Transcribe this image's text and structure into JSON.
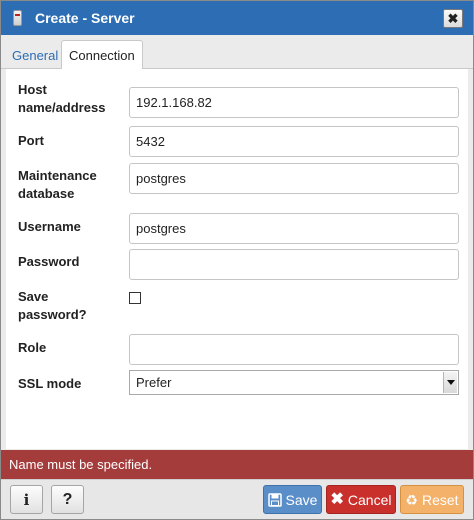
{
  "window": {
    "title": "Create - Server",
    "close_glyph": "✖",
    "title_icon": "server-icon"
  },
  "tabs": [
    {
      "label": "General",
      "active": false
    },
    {
      "label": "Connection",
      "active": true
    }
  ],
  "form": {
    "host": {
      "label": "Host\nname/address",
      "value": "192.1.168.82"
    },
    "port": {
      "label": "Port",
      "value": "5432"
    },
    "maintenance_db": {
      "label": "Maintenance\ndatabase",
      "value": "postgres"
    },
    "username": {
      "label": "Username",
      "value": "postgres"
    },
    "password": {
      "label": "Password",
      "value": ""
    },
    "save_password": {
      "label": "Save\npassword?",
      "checked": false
    },
    "role": {
      "label": "Role",
      "value": ""
    },
    "ssl_mode": {
      "label": "SSL mode",
      "value": "Prefer"
    }
  },
  "error": {
    "message": "Name must be specified."
  },
  "footer": {
    "info_glyph": "i",
    "help_glyph": "?",
    "save_label": "Save",
    "cancel_label": "Cancel",
    "reset_label": "Reset",
    "save_icon": "floppy-disk-icon",
    "cancel_icon": "close-icon",
    "reset_icon": "recycle-icon"
  },
  "colors": {
    "titlebar": "#2c6db3",
    "error": "#a43c3c",
    "save": "#5a8ec8",
    "cancel": "#c9302c",
    "reset": "#f4b16a"
  }
}
